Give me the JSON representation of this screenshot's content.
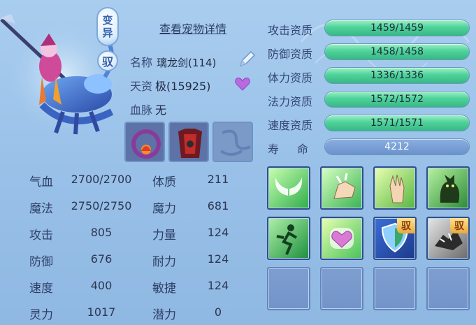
{
  "pet": {
    "mutant_badge": [
      "变",
      "异"
    ],
    "ride_badge": "驭",
    "detail_link": "查看宠物详情",
    "name_label": "名称",
    "name_value": "璃龙剑(114)",
    "talent_label": "天资",
    "talent_value": "极(15925)",
    "bloodline_label": "血脉",
    "bloodline_value": "无"
  },
  "stats": [
    {
      "label": "气血",
      "value": "2700/2700"
    },
    {
      "label": "魔法",
      "value": "2750/2750"
    },
    {
      "label": "攻击",
      "value": "805"
    },
    {
      "label": "防御",
      "value": "676"
    },
    {
      "label": "速度",
      "value": "400"
    },
    {
      "label": "灵力",
      "value": "1017"
    }
  ],
  "attributes": [
    {
      "label": "体质",
      "value": "211"
    },
    {
      "label": "魔力",
      "value": "681"
    },
    {
      "label": "力量",
      "value": "124"
    },
    {
      "label": "耐力",
      "value": "124"
    },
    {
      "label": "敏捷",
      "value": "124"
    },
    {
      "label": "潜力",
      "value": "0"
    }
  ],
  "aptitudes": [
    {
      "label": "攻击资质",
      "value": "1459/1459",
      "fill": 1.0
    },
    {
      "label": "防御资质",
      "value": "1458/1458",
      "fill": 1.0
    },
    {
      "label": "体力资质",
      "value": "1336/1336",
      "fill": 1.0
    },
    {
      "label": "法力资质",
      "value": "1572/1572",
      "fill": 1.0
    },
    {
      "label": "速度资质",
      "value": "1571/1571",
      "fill": 1.0
    }
  ],
  "lifespan": {
    "label": "寿命",
    "value": "4212"
  },
  "skills": [
    {
      "icon": "angel-wings-icon",
      "tag": ""
    },
    {
      "icon": "finger-snap-icon",
      "tag": ""
    },
    {
      "icon": "raised-palm-icon",
      "tag": ""
    },
    {
      "icon": "shadow-cat-icon",
      "tag": ""
    },
    {
      "icon": "running-figure-icon",
      "tag": ""
    },
    {
      "icon": "heart-icon",
      "tag": ""
    },
    {
      "icon": "shield-icon",
      "tag": "驭"
    },
    {
      "icon": "shattered-rock-icon",
      "tag": "驭"
    }
  ],
  "colors": {
    "background": "#a9cdef",
    "aptitude_bar": "#4fd39a",
    "lifespan_bar": "#6c92cd",
    "ride_tag": "#e8a93c"
  }
}
